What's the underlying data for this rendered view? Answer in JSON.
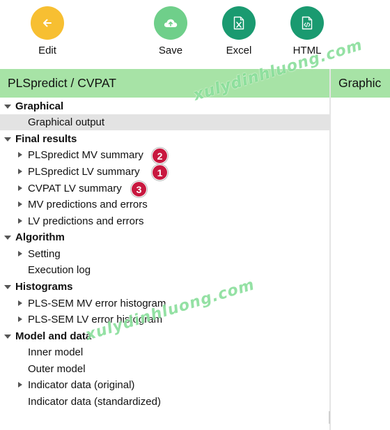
{
  "toolbar": {
    "edit": {
      "label": "Edit",
      "icon": "arrow-left-icon",
      "color": "#f7bf32"
    },
    "save": {
      "label": "Save",
      "icon": "cloud-upload-icon",
      "color": "#6fcf8a"
    },
    "excel": {
      "label": "Excel",
      "icon": "excel-file-icon",
      "color": "#1a9a70"
    },
    "html": {
      "label": "HTML",
      "icon": "html-file-icon",
      "color": "#1a9a70"
    }
  },
  "left_panel": {
    "title": "PLSpredict / CVPAT",
    "header_color": "#a7e3a6"
  },
  "right_panel": {
    "title": "Graphic"
  },
  "tree": {
    "graphical": {
      "label": "Graphical",
      "items": [
        "Graphical output"
      ]
    },
    "final_results": {
      "label": "Final results",
      "items": [
        "PLSpredict MV summary",
        "PLSpredict LV summary",
        "CVPAT LV summary",
        "MV predictions and errors",
        "LV predictions and errors"
      ]
    },
    "algorithm": {
      "label": "Algorithm",
      "items": [
        "Setting",
        "Execution log"
      ]
    },
    "histograms": {
      "label": "Histograms",
      "items": [
        "PLS-SEM MV error histogram",
        "PLS-SEM LV error histogram"
      ]
    },
    "model_and_data": {
      "label": "Model and data",
      "items": [
        "Inner model",
        "Outer model",
        "Indicator data (original)",
        "Indicator data (standardized)"
      ]
    }
  },
  "badges": [
    "2",
    "1",
    "3"
  ],
  "badge_color": "#c8183f",
  "watermarks": [
    "xulydinhluong.com",
    "xulydinhluong.com"
  ]
}
